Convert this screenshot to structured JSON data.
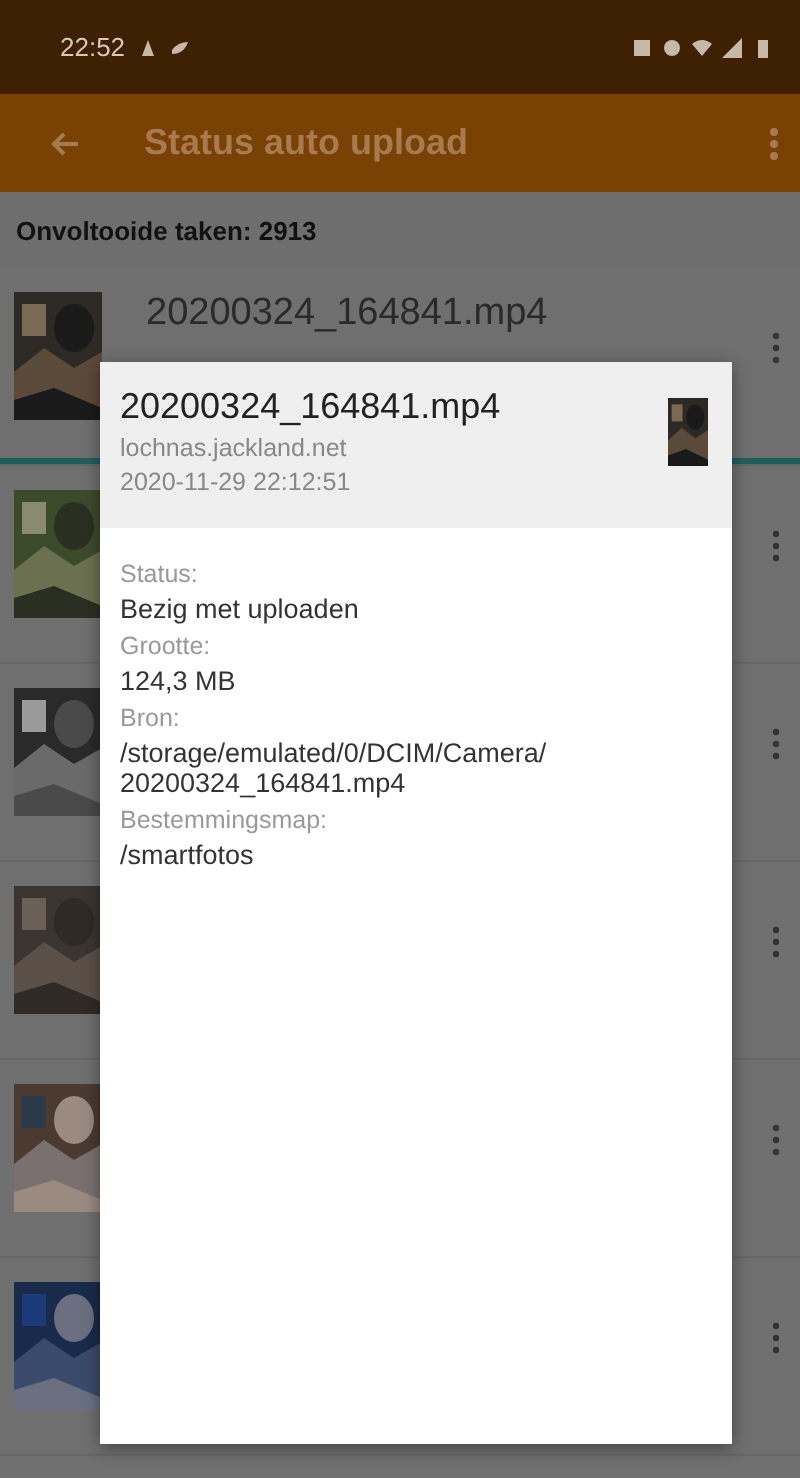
{
  "status_bar": {
    "time": "22:52"
  },
  "app_bar": {
    "title": "Status auto upload"
  },
  "subheader": "Onvoltooide taken: 2913",
  "rows": [
    {
      "title": "20200324_164841.mp4",
      "thumbnail": {
        "kind": "picture"
      }
    },
    {
      "thumbnail": {
        "kind": "picture"
      }
    },
    {
      "thumbnail": {
        "kind": "picture"
      }
    },
    {
      "thumbnail": {
        "kind": "picture"
      }
    },
    {
      "thumbnail": {
        "kind": "picture"
      }
    },
    {
      "thumbnail": {
        "kind": "picture"
      }
    }
  ],
  "dialog": {
    "title": "20200324_164841.mp4",
    "host": "lochnas.jackland.net",
    "date": "2020-11-29 22:12:51",
    "thumbnail": {
      "kind": "picture"
    },
    "fields": [
      {
        "label": "Status:",
        "value": "Bezig met uploaden"
      },
      {
        "label": "Grootte:",
        "value": "124,3 MB"
      },
      {
        "label": "Bron:",
        "value": "/storage/emulated/0/DCIM/Camera/\n20200324_164841.mp4"
      },
      {
        "label": "Bestemmingsmap:",
        "value": "/smartfotos"
      }
    ]
  }
}
